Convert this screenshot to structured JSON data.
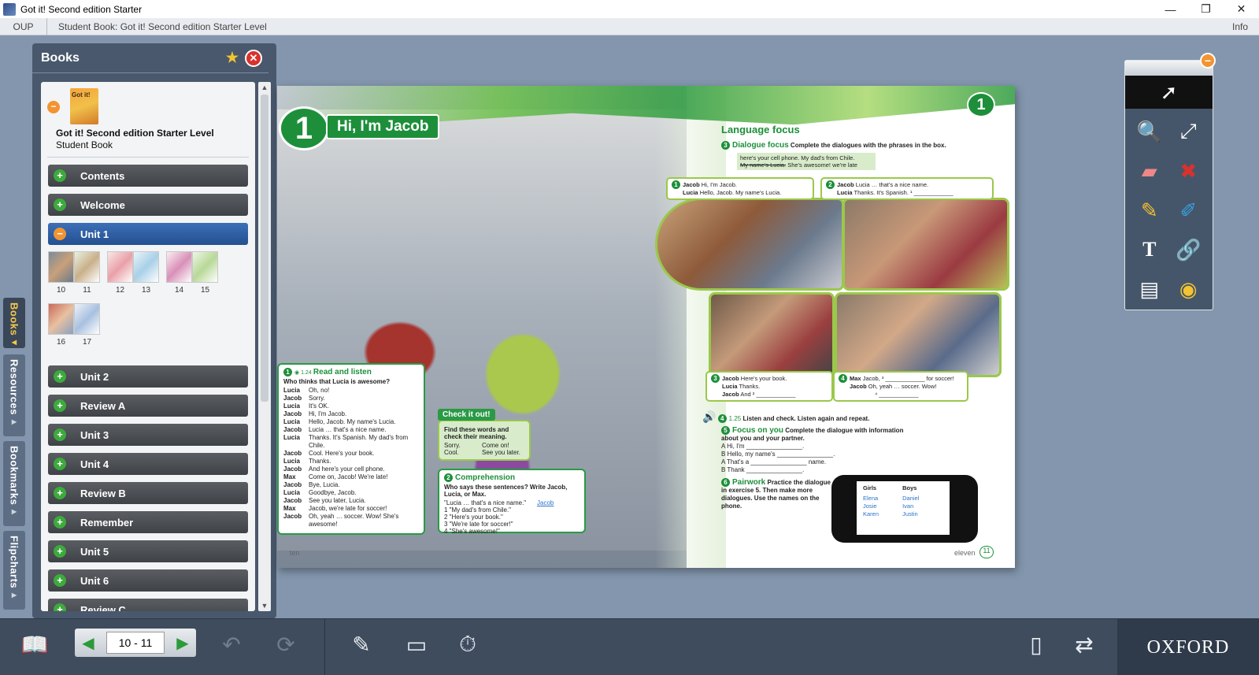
{
  "window": {
    "title": "Got it! Second edition Starter",
    "min": "—",
    "max": "❐",
    "close": "✕"
  },
  "menubar": {
    "oup": "OUP",
    "breadcrumb": "Student Book: Got it! Second edition Starter Level",
    "info": "Info"
  },
  "vtabs": [
    {
      "label": "Books",
      "active": true
    },
    {
      "label": "Resources",
      "active": false
    },
    {
      "label": "Bookmarks",
      "active": false
    },
    {
      "label": "Flipcharts",
      "active": false
    }
  ],
  "books_panel": {
    "title": "Books",
    "book_title": "Got it! Second edition Starter Level",
    "book_subtitle": "Student Book",
    "sections_top": [
      "Contents",
      "Welcome"
    ],
    "active_section": "Unit 1",
    "thumb_pairs": [
      [
        "10",
        "11"
      ],
      [
        "12",
        "13"
      ],
      [
        "14",
        "15"
      ],
      [
        "16",
        "17"
      ]
    ],
    "sections_bottom": [
      "Unit 2",
      "Review A",
      "Unit 3",
      "Unit 4",
      "Review B",
      "Remember",
      "Unit 5",
      "Unit 6",
      "Review C"
    ]
  },
  "spread": {
    "unit_number": "1",
    "unit_title": "Hi, I'm Jacob",
    "read_listen": {
      "heading": "Read and listen",
      "audio": "1.24",
      "number": "1",
      "question": "Who thinks that Lucia is awesome?",
      "lines": [
        [
          "Lucia",
          "Oh, no!"
        ],
        [
          "Jacob",
          "Sorry."
        ],
        [
          "Lucia",
          "It's OK."
        ],
        [
          "Jacob",
          "Hi, I'm Jacob."
        ],
        [
          "Lucia",
          "Hello, Jacob. My name's Lucia."
        ],
        [
          "Jacob",
          "Lucia … that's a nice name."
        ],
        [
          "Lucia",
          "Thanks. It's Spanish. My dad's from Chile."
        ],
        [
          "Jacob",
          "Cool. Here's your book."
        ],
        [
          "Lucia",
          "Thanks."
        ],
        [
          "Jacob",
          "And here's your cell phone."
        ],
        [
          "Max",
          "Come on, Jacob! We're late!"
        ],
        [
          "Jacob",
          "Bye, Lucia."
        ],
        [
          "Lucia",
          "Goodbye, Jacob."
        ],
        [
          "Jacob",
          "See you later, Lucia."
        ],
        [
          "Max",
          "Jacob, we're late for soccer!"
        ],
        [
          "Jacob",
          "Oh, yeah … soccer. Wow! She's awesome!"
        ]
      ]
    },
    "check_it_out": {
      "tag": "Check it out!",
      "text": "Find these words and check their meaning.",
      "words": [
        [
          "Sorry.",
          "Come on!"
        ],
        [
          "Cool.",
          "See you later."
        ]
      ]
    },
    "comprehension": {
      "number": "2",
      "heading": "Comprehension",
      "question": "Who says these sentences? Write Jacob, Lucia, or Max.",
      "items": [
        "\"Lucia … that's a nice name.\"",
        "1  \"My dad's from Chile.\"",
        "2  \"Here's your book.\"",
        "3  \"We're late for soccer!\"",
        "4  \"She's awesome!\""
      ],
      "answer": "Jacob"
    },
    "left_page_label": "ten",
    "language_focus": "Language focus",
    "dialogue_focus": {
      "number": "3",
      "heading": "Dialogue focus",
      "instruction": "Complete the dialogues with the phrases in the box.",
      "phrases_line1": "here's your cell phone.   My dad's from Chile.",
      "phrase_struck": "My name's Lucia.",
      "phrases_line2": "She's awesome!   we're late"
    },
    "captions": {
      "c1": {
        "n": "1",
        "l1a": "Jacob",
        "l1b": "Hi, I'm Jacob.",
        "l2a": "Lucia",
        "l2b": "Hello, Jacob. My name's Lucia."
      },
      "c2": {
        "n": "2",
        "l1a": "Jacob",
        "l1b": "Lucia … that's a nice name.",
        "l2a": "Lucia",
        "l2b": "Thanks. It's Spanish. ¹ ____________"
      },
      "c3": {
        "n": "3",
        "l1a": "Jacob",
        "l1b": "Here's your book.",
        "l2a": "Lucia",
        "l2b": "Thanks.",
        "l3a": "Jacob",
        "l3b": "And ² ____________"
      },
      "c4": {
        "n": "4",
        "l1a": "Max",
        "l1b": "Jacob, ³ ____________ for soccer!",
        "l2a": "Jacob",
        "l2b": "Oh, yeah … soccer. Wow!",
        "l3b": "⁴ ____________"
      }
    },
    "ex4": {
      "number": "4",
      "audio": "1.25",
      "text": "Listen and check. Listen again and repeat."
    },
    "ex5": {
      "number": "5",
      "heading": "Focus on you",
      "text": "Complete the dialogue with information about you and your partner.",
      "lines": [
        "A  Hi, I'm ________________.",
        "B  Hello, my name's ________________.",
        "A  That's a ________________ name.",
        "B  Thank ________________."
      ]
    },
    "ex6": {
      "number": "6",
      "heading": "Pairwork",
      "text": "Practice the dialogue in exercise 5. Then make more dialogues. Use the names on the phone."
    },
    "phone": {
      "girls_label": "Girls",
      "boys_label": "Boys",
      "girls": [
        "Elena",
        "Josie",
        "Karen"
      ],
      "boys": [
        "Daniel",
        "Ivan",
        "Justin"
      ]
    },
    "right_page_label": "eleven",
    "right_page_number": "11"
  },
  "toolbar": {
    "page_value": "10 - 11",
    "brand": "OXFORD"
  },
  "colors": {
    "accent_green": "#1d8f3a",
    "panel_bg": "#49586c",
    "active_blue": "#2f5fa3",
    "close_red": "#d9322d"
  }
}
